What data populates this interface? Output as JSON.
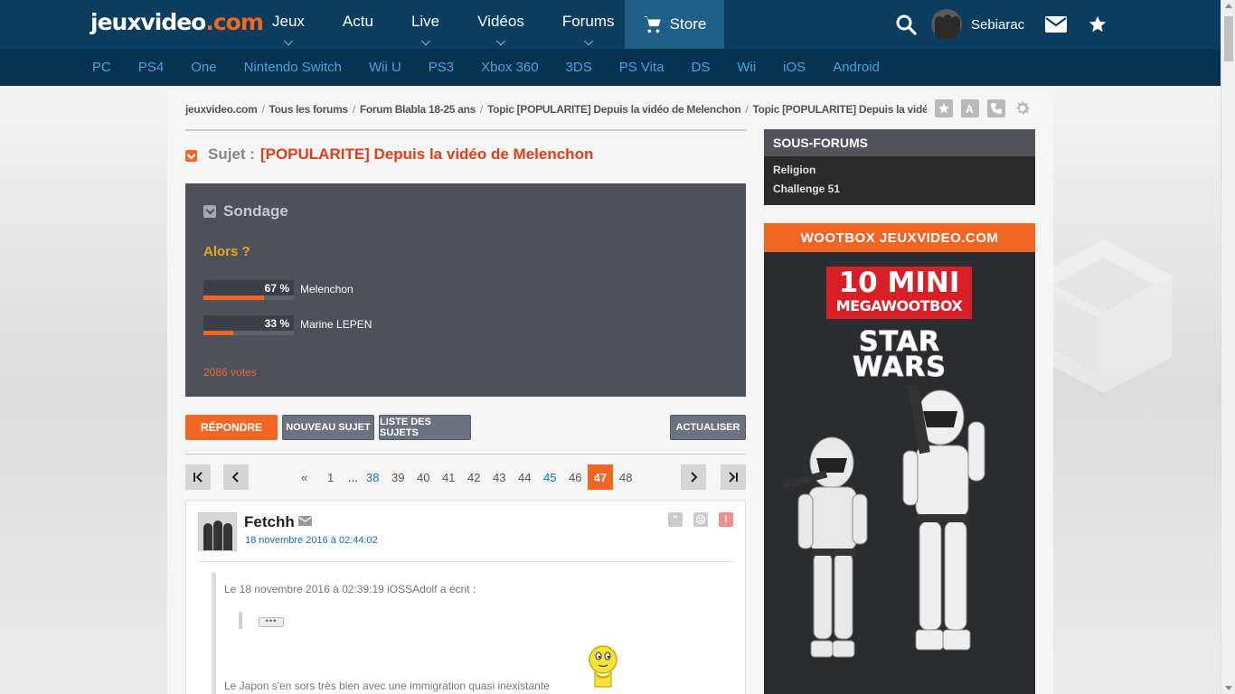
{
  "header": {
    "logo_main": "jeuxvideo",
    "logo_tld": ".com",
    "nav": [
      {
        "label": "Jeux",
        "has_dropdown": true
      },
      {
        "label": "Actu",
        "has_dropdown": false
      },
      {
        "label": "Live",
        "has_dropdown": true
      },
      {
        "label": "Vidéos",
        "has_dropdown": true
      },
      {
        "label": "Forums",
        "has_dropdown": true
      }
    ],
    "store_label": "Store",
    "username": "Sebiarac"
  },
  "subnav": [
    "PC",
    "PS4",
    "One",
    "Nintendo Switch",
    "Wii U",
    "PS3",
    "Xbox 360",
    "3DS",
    "PS Vita",
    "DS",
    "Wii",
    "iOS",
    "Android"
  ],
  "breadcrumb": [
    "jeuxvideo.com",
    "Tous les forums",
    "Forum Blabla 18-25 ans",
    "Topic [POPULARITE] Depuis la vidéo de Melenchon",
    "Topic [POPULARITE] Depuis la vidéo de Melenchon - Pa..."
  ],
  "subject": {
    "label": "Sujet :",
    "title": "[POPULARITE] Depuis la vidéo de Melenchon"
  },
  "poll": {
    "header": "Sondage",
    "question": "Alors ?",
    "answers": [
      {
        "label": "Melenchon",
        "percent_text": "67 %",
        "percent": 67
      },
      {
        "label": "Marine LEPEN",
        "percent_text": "33 %",
        "percent": 33
      }
    ],
    "votes": "2086 votes"
  },
  "buttons": {
    "reply": "RÉPONDRE",
    "new_topic": "NOUVEAU SUJET",
    "topic_list": "LISTE DES SUJETS",
    "refresh": "ACTUALISER"
  },
  "pagination": {
    "prev_marker": "«",
    "first": "1",
    "dots": "...",
    "pages": [
      "38",
      "39",
      "40",
      "41",
      "42",
      "43",
      "44",
      "45",
      "46"
    ],
    "current": "47",
    "next_page": "48"
  },
  "post": {
    "author": "Fetchh",
    "date": "18 novembre 2016 à 02:44:02",
    "quote_header": "Le 18 novembre 2016 à 02:39:19 iOSSAdolf a écrit :",
    "text": "Le Japon s'en sors très bien avec une immigration quasi inexistante"
  },
  "sidebar": {
    "title": "SOUS-FORUMS",
    "items": [
      "Religion",
      "Challenge 51"
    ]
  },
  "ad": {
    "header": "WOOTBOX JEUXVIDEO.COM",
    "line1": "10 MINI",
    "line2": "MEGAWOOTBOX",
    "brand1": "STAR",
    "brand2": "WARS"
  },
  "colors": {
    "accent": "#f26522",
    "topbar": "#0a3d5e",
    "subnav": "#04324f",
    "link": "#1a6fb5"
  }
}
